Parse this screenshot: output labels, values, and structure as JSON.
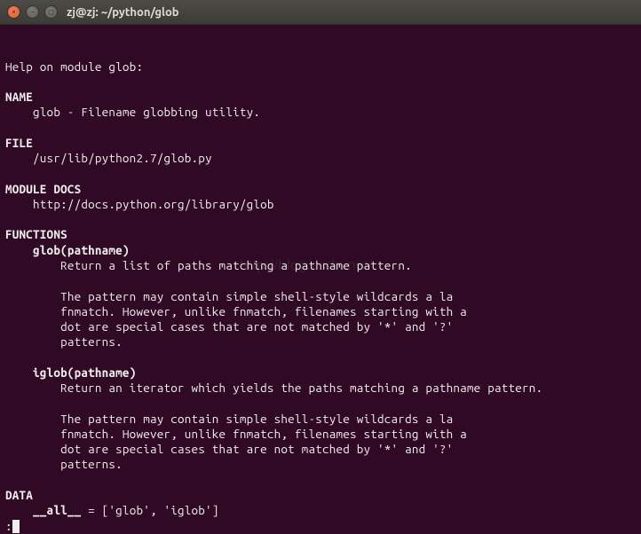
{
  "window": {
    "title": "zj@zj: ~/python/glob",
    "buttons": {
      "close_glyph": "×",
      "min_glyph": "–",
      "max_glyph": "▢"
    }
  },
  "watermark": "http://blog.csdn.net/",
  "help": {
    "header": "Help on module glob:",
    "sections": {
      "name": {
        "label": "NAME",
        "line": "    glob - Filename globbing utility."
      },
      "file": {
        "label": "FILE",
        "line": "    /usr/lib/python2.7/glob.py"
      },
      "docs": {
        "label": "MODULE DOCS",
        "line": "    http://docs.python.org/library/glob"
      },
      "functions": {
        "label": "FUNCTIONS",
        "glob_sig": "    glob(pathname)",
        "glob_desc1": "        Return a list of paths matching a pathname pattern.",
        "glob_desc2": "        The pattern may contain simple shell-style wildcards a la",
        "glob_desc3": "        fnmatch. However, unlike fnmatch, filenames starting with a",
        "glob_desc4": "        dot are special cases that are not matched by '*' and '?'",
        "glob_desc5": "        patterns.",
        "iglob_sig": "    iglob(pathname)",
        "iglob_desc1": "        Return an iterator which yields the paths matching a pathname pattern.",
        "iglob_desc2": "        The pattern may contain simple shell-style wildcards a la",
        "iglob_desc3": "        fnmatch. However, unlike fnmatch, filenames starting with a",
        "iglob_desc4": "        dot are special cases that are not matched by '*' and '?'",
        "iglob_desc5": "        patterns."
      },
      "data": {
        "label": "DATA",
        "all_label": "    __all__",
        "all_value": " = ['glob', 'iglob']"
      }
    },
    "prompt": ":"
  }
}
